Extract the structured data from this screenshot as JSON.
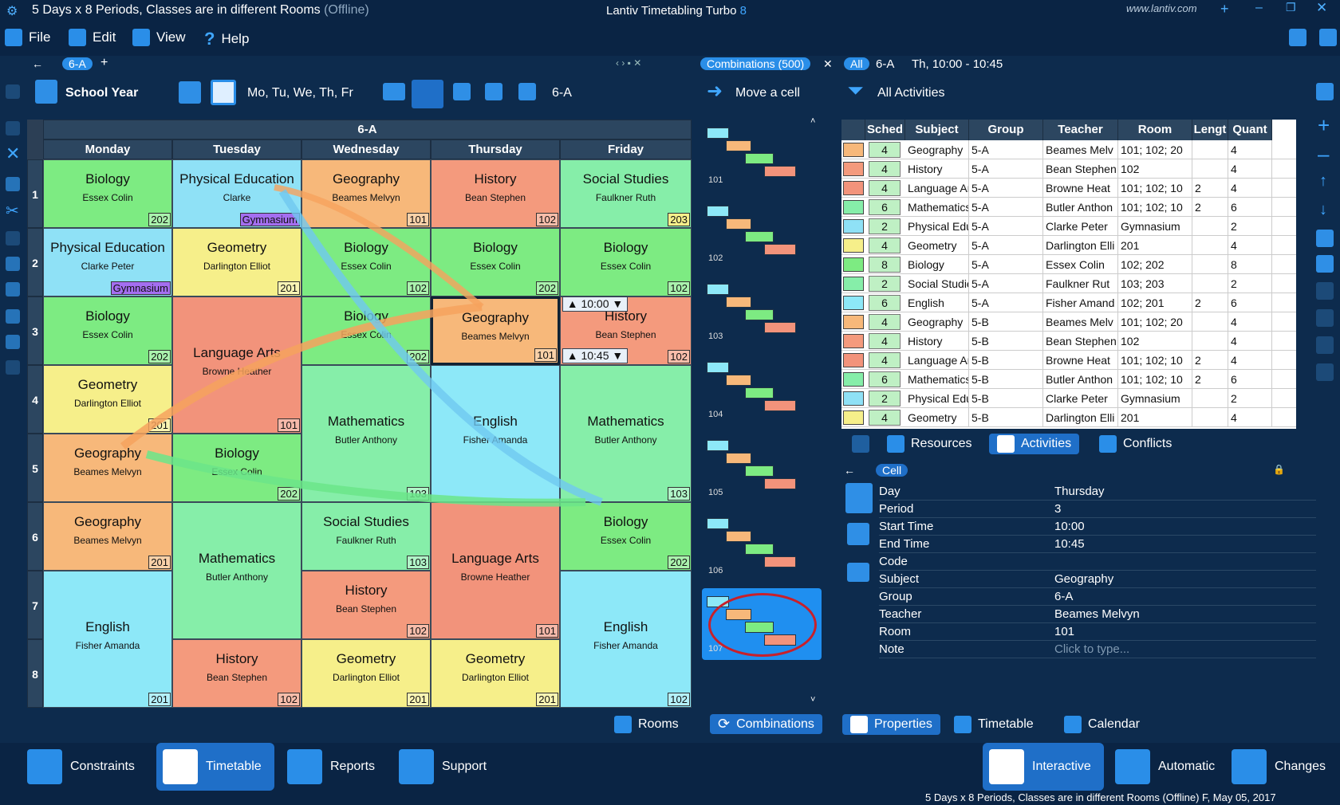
{
  "window": {
    "title": "5 Days x 8 Periods, Classes are in different Rooms",
    "status": "(Offline)",
    "app_name": "Lantiv Timetabling Turbo",
    "app_version": "8",
    "website": "www.lantiv.com"
  },
  "menu": [
    "File",
    "Edit",
    "View",
    "Help"
  ],
  "toolbar": {
    "tab": "6-A",
    "school_year": "School Year",
    "days": "Mo, Tu, We, Th, Fr",
    "class_label": "6-A",
    "combinations": "Combinations (500)",
    "move_cell": "Move a cell",
    "filter_all": "All",
    "filter_class": "6-A",
    "filter_time": "Th, 10:00 - 10:45",
    "all_activities": "All Activities"
  },
  "timetable": {
    "header": "6-A",
    "days": [
      "Monday",
      "Tuesday",
      "Wednesday",
      "Thursday",
      "Friday"
    ],
    "periods": [
      "1",
      "2",
      "3",
      "4",
      "5",
      "6",
      "7",
      "8"
    ],
    "cells": [
      {
        "day": 0,
        "p": 0,
        "span": 1,
        "subject": "Biology",
        "teacher": "Essex Colin",
        "room": "202",
        "color": "#7deb82"
      },
      {
        "day": 0,
        "p": 1,
        "span": 1,
        "subject": "Physical Education",
        "teacher": "Clarke Peter",
        "room": "Gymnasium",
        "color": "#8fe1f6",
        "roomColor": "#a46ef0"
      },
      {
        "day": 0,
        "p": 2,
        "span": 1,
        "subject": "Biology",
        "teacher": "Essex Colin",
        "room": "202",
        "color": "#7deb82"
      },
      {
        "day": 0,
        "p": 3,
        "span": 1,
        "subject": "Geometry",
        "teacher": "Darlington Elliot",
        "room": "201",
        "color": "#f6ef8a"
      },
      {
        "day": 0,
        "p": 4,
        "span": 1,
        "subject": "Geography",
        "teacher": "Beames Melvyn",
        "room": "",
        "color": "#f7b87a"
      },
      {
        "day": 0,
        "p": 5,
        "span": 1,
        "subject": "Geography",
        "teacher": "Beames Melvyn",
        "room": "201",
        "color": "#f7b87a"
      },
      {
        "day": 0,
        "p": 6,
        "span": 2,
        "subject": "English",
        "teacher": "Fisher Amanda",
        "room": "201",
        "color": "#8de8f8"
      },
      {
        "day": 1,
        "p": 0,
        "span": 1,
        "subject": "Physical Education",
        "teacher": "Clarke",
        "room": "Gymnasium",
        "color": "#8fe1f6",
        "roomColor": "#a46ef0"
      },
      {
        "day": 1,
        "p": 1,
        "span": 1,
        "subject": "Geometry",
        "teacher": "Darlington Elliot",
        "room": "201",
        "color": "#f6ef8a"
      },
      {
        "day": 1,
        "p": 2,
        "span": 2,
        "subject": "Language Arts",
        "teacher": "Browne Heather",
        "room": "101",
        "color": "#f2937b"
      },
      {
        "day": 1,
        "p": 4,
        "span": 1,
        "subject": "Biology",
        "teacher": "Essex Colin",
        "room": "202",
        "color": "#7deb82"
      },
      {
        "day": 1,
        "p": 5,
        "span": 2,
        "subject": "Mathematics",
        "teacher": "Butler Anthony",
        "room": "",
        "color": "#86eea9"
      },
      {
        "day": 1,
        "p": 7,
        "span": 1,
        "subject": "History",
        "teacher": "Bean Stephen",
        "room": "102",
        "color": "#f49a7d"
      },
      {
        "day": 2,
        "p": 0,
        "span": 1,
        "subject": "Geography",
        "teacher": "Beames Melvyn",
        "room": "101",
        "color": "#f7b87a"
      },
      {
        "day": 2,
        "p": 1,
        "span": 1,
        "subject": "Biology",
        "teacher": "Essex Colin",
        "room": "102",
        "color": "#7deb82"
      },
      {
        "day": 2,
        "p": 2,
        "span": 1,
        "subject": "Biology",
        "teacher": "Essex Colin",
        "room": "202",
        "color": "#7deb82"
      },
      {
        "day": 2,
        "p": 3,
        "span": 2,
        "subject": "Mathematics",
        "teacher": "Butler Anthony",
        "room": "103",
        "color": "#86eea9"
      },
      {
        "day": 2,
        "p": 5,
        "span": 1,
        "subject": "Social Studies",
        "teacher": "Faulkner Ruth",
        "room": "103",
        "color": "#86eea9"
      },
      {
        "day": 2,
        "p": 6,
        "span": 1,
        "subject": "History",
        "teacher": "Bean Stephen",
        "room": "102",
        "color": "#f49a7d"
      },
      {
        "day": 2,
        "p": 7,
        "span": 1,
        "subject": "Geometry",
        "teacher": "Darlington Elliot",
        "room": "201",
        "color": "#f6ef8a"
      },
      {
        "day": 3,
        "p": 0,
        "span": 1,
        "subject": "History",
        "teacher": "Bean Stephen",
        "room": "102",
        "color": "#f49a7d"
      },
      {
        "day": 3,
        "p": 1,
        "span": 1,
        "subject": "Biology",
        "teacher": "Essex Colin",
        "room": "202",
        "color": "#7deb82"
      },
      {
        "day": 3,
        "p": 2,
        "span": 1,
        "subject": "Geography",
        "teacher": "Beames Melvyn",
        "room": "101",
        "color": "#f7b87a",
        "selected": true
      },
      {
        "day": 3,
        "p": 3,
        "span": 2,
        "subject": "English",
        "teacher": "Fisher Amanda",
        "room": "",
        "color": "#8de8f8"
      },
      {
        "day": 3,
        "p": 5,
        "span": 2,
        "subject": "Language Arts",
        "teacher": "Browne Heather",
        "room": "101",
        "color": "#f2937b"
      },
      {
        "day": 3,
        "p": 7,
        "span": 1,
        "subject": "Geometry",
        "teacher": "Darlington Elliot",
        "room": "201",
        "color": "#f6ef8a"
      },
      {
        "day": 4,
        "p": 0,
        "span": 1,
        "subject": "Social Studies",
        "teacher": "Faulkner Ruth",
        "room": "203",
        "color": "#86eea9",
        "roomColor": "#f6ef8a"
      },
      {
        "day": 4,
        "p": 1,
        "span": 1,
        "subject": "Biology",
        "teacher": "Essex Colin",
        "room": "102",
        "color": "#7deb82"
      },
      {
        "day": 4,
        "p": 2,
        "span": 1,
        "subject": "History",
        "teacher": "Bean Stephen",
        "room": "102",
        "color": "#f49a7d"
      },
      {
        "day": 4,
        "p": 3,
        "span": 2,
        "subject": "Mathematics",
        "teacher": "Butler Anthony",
        "room": "103",
        "color": "#86eea9"
      },
      {
        "day": 4,
        "p": 5,
        "span": 1,
        "subject": "Biology",
        "teacher": "Essex Colin",
        "room": "202",
        "color": "#7deb82"
      },
      {
        "day": 4,
        "p": 6,
        "span": 2,
        "subject": "English",
        "teacher": "Fisher Amanda",
        "room": "102",
        "color": "#8de8f8"
      }
    ],
    "time_start": "10:00",
    "time_end": "10:45"
  },
  "combinations": [
    "101",
    "102",
    "103",
    "104",
    "105",
    "106",
    "107"
  ],
  "activities": {
    "columns": [
      "Sched",
      "Subject",
      "Group",
      "Teacher",
      "Room",
      "Lengt",
      "Quant"
    ],
    "rows": [
      {
        "color": "#f7b87a",
        "sched": "4",
        "subject": "Geography",
        "group": "5-A",
        "teacher": "Beames Melv",
        "room": "101; 102; 20",
        "len": "",
        "qty": "4"
      },
      {
        "color": "#f49a7d",
        "sched": "4",
        "subject": "History",
        "group": "5-A",
        "teacher": "Bean Stephen",
        "room": "102",
        "len": "",
        "qty": "4"
      },
      {
        "color": "#f2937b",
        "sched": "4",
        "subject": "Language Art",
        "group": "5-A",
        "teacher": "Browne Heat",
        "room": "101; 102; 10",
        "len": "2",
        "qty": "4"
      },
      {
        "color": "#86eea9",
        "sched": "6",
        "subject": "Mathematics",
        "group": "5-A",
        "teacher": "Butler Anthon",
        "room": "101; 102; 10",
        "len": "2",
        "qty": "6"
      },
      {
        "color": "#8fe1f6",
        "sched": "2",
        "subject": "Physical Educ",
        "group": "5-A",
        "teacher": "Clarke Peter",
        "room": "Gymnasium",
        "len": "",
        "qty": "2"
      },
      {
        "color": "#f6ef8a",
        "sched": "4",
        "subject": "Geometry",
        "group": "5-A",
        "teacher": "Darlington Elli",
        "room": "201",
        "len": "",
        "qty": "4"
      },
      {
        "color": "#7deb82",
        "sched": "8",
        "subject": "Biology",
        "group": "5-A",
        "teacher": "Essex Colin",
        "room": "102; 202",
        "len": "",
        "qty": "8"
      },
      {
        "color": "#86eea9",
        "sched": "2",
        "subject": "Social Studies",
        "group": "5-A",
        "teacher": "Faulkner Rut",
        "room": "103; 203",
        "len": "",
        "qty": "2"
      },
      {
        "color": "#8de8f8",
        "sched": "6",
        "subject": "English",
        "group": "5-A",
        "teacher": "Fisher Amand",
        "room": "102; 201",
        "len": "2",
        "qty": "6"
      },
      {
        "color": "#f7b87a",
        "sched": "4",
        "subject": "Geography",
        "group": "5-B",
        "teacher": "Beames Melv",
        "room": "101; 102; 20",
        "len": "",
        "qty": "4"
      },
      {
        "color": "#f49a7d",
        "sched": "4",
        "subject": "History",
        "group": "5-B",
        "teacher": "Bean Stephen",
        "room": "102",
        "len": "",
        "qty": "4"
      },
      {
        "color": "#f2937b",
        "sched": "4",
        "subject": "Language Art",
        "group": "5-B",
        "teacher": "Browne Heat",
        "room": "101; 102; 10",
        "len": "2",
        "qty": "4"
      },
      {
        "color": "#86eea9",
        "sched": "6",
        "subject": "Mathematics",
        "group": "5-B",
        "teacher": "Butler Anthon",
        "room": "101; 102; 10",
        "len": "2",
        "qty": "6"
      },
      {
        "color": "#8fe1f6",
        "sched": "2",
        "subject": "Physical Educ",
        "group": "5-B",
        "teacher": "Clarke Peter",
        "room": "Gymnasium",
        "len": "",
        "qty": "2"
      },
      {
        "color": "#f6ef8a",
        "sched": "4",
        "subject": "Geometry",
        "group": "5-B",
        "teacher": "Darlington Elli",
        "room": "201",
        "len": "",
        "qty": "4"
      }
    ]
  },
  "right_tabs": [
    "Resources",
    "Activities",
    "Conflicts"
  ],
  "cell_tab": "Cell",
  "properties": [
    {
      "k": "Day",
      "v": "Thursday"
    },
    {
      "k": "Period",
      "v": "3"
    },
    {
      "k": "Start Time",
      "v": "10:00"
    },
    {
      "k": "End Time",
      "v": "10:45"
    },
    {
      "k": "Code",
      "v": ""
    },
    {
      "k": "Subject",
      "v": "Geography"
    },
    {
      "k": "Group",
      "v": "6-A"
    },
    {
      "k": "Teacher",
      "v": "Beames Melvyn"
    },
    {
      "k": "Room",
      "v": "101"
    },
    {
      "k": "Note",
      "v": "Click to type..."
    }
  ],
  "bottom_tabs": [
    "Rooms",
    "Combinations",
    "Properties",
    "Timetable",
    "Calendar"
  ],
  "nav": [
    "Constraints",
    "Timetable",
    "Reports",
    "Support"
  ],
  "modes": [
    "Interactive",
    "Automatic",
    "Changes"
  ],
  "status_bar": "5 Days x 8 Periods, Classes are in different Rooms (Offline) F, May 05, 2017"
}
